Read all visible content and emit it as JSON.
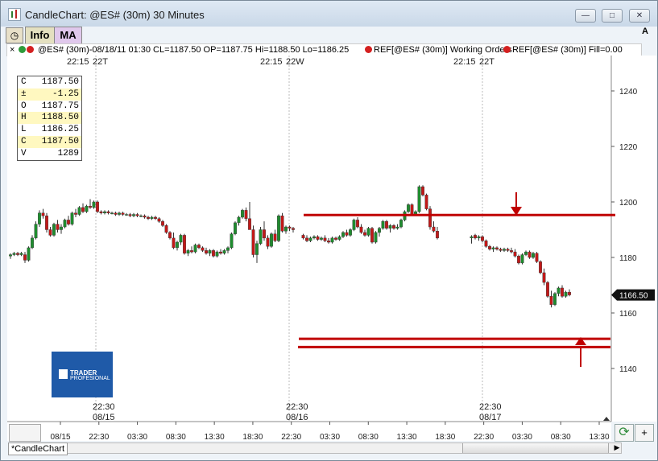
{
  "window": {
    "title": "CandleChart: @ES# (30m) 30 Minutes",
    "controls": [
      "minimize",
      "restore",
      "close"
    ]
  },
  "toolbar": {
    "clock_icon": "clock-icon",
    "info_label": "Info",
    "ma_label": "MA",
    "corner_label": "A"
  },
  "legend": {
    "close_glyph": "×",
    "series": "@ES# (30m)-08/18/11 01:30 CL=1187.50 OP=1187.75 Hi=1188.50 Lo=1186.25",
    "ref1": "REF[@ES# (30m)] Working Orders",
    "ref2": "REF[@ES# (30m)] Fill=0.00",
    "dot_colors": [
      "#2e9b3a",
      "#d42020"
    ]
  },
  "m_button": "M",
  "ohlc_box": [
    {
      "label": "C",
      "value": "1187.50",
      "highlight": false
    },
    {
      "label": "±",
      "value": "-1.25",
      "highlight": true
    },
    {
      "label": "O",
      "value": "1187.75",
      "highlight": false
    },
    {
      "label": "H",
      "value": "1188.50",
      "highlight": true
    },
    {
      "label": "L",
      "value": "1186.25",
      "highlight": false
    },
    {
      "label": "C",
      "value": "1187.50",
      "highlight": true
    },
    {
      "label": "V",
      "value": "1289",
      "highlight": false
    }
  ],
  "brand": {
    "line1": "TRADER",
    "line2": "PROFESIONAL"
  },
  "session_markers": {
    "top": [
      {
        "time": "22:15",
        "day": "22T"
      },
      {
        "time": "22:15",
        "day": "22W"
      },
      {
        "time": "22:15",
        "day": "22T"
      }
    ],
    "bottom": [
      {
        "time": "22:30",
        "date": "08/15"
      },
      {
        "time": "22:30",
        "date": "08/16"
      },
      {
        "time": "22:30",
        "date": "08/17"
      }
    ]
  },
  "current_price": "1166.50",
  "tab_label": "*CandleChart",
  "refresh_icon": "refresh-icon",
  "plus_label": "+",
  "chart_data": {
    "type": "candlestick",
    "title": "CandleChart: @ES# (30m) 30 Minutes",
    "symbol": "@ES# (30m)",
    "y_ticks": [
      1140,
      1160,
      1180,
      1200,
      1220,
      1240
    ],
    "ylim": [
      1133,
      1255
    ],
    "x_tick_labels": [
      "08/15",
      "22:30",
      "03:30",
      "08:30",
      "13:30",
      "18:30",
      "22:30",
      "03:30",
      "08:30",
      "13:30",
      "18:30",
      "22:30",
      "03:30",
      "08:30",
      "13:30"
    ],
    "last_price": 1166.5,
    "horizontal_levels": [
      {
        "value": 1195.3,
        "color": "#c00000",
        "x_range_idx": [
          121,
          248
        ],
        "marker": "down-arrow"
      },
      {
        "value": 1150.7,
        "color": "#c00000",
        "x_range_idx": [
          120,
          248
        ]
      },
      {
        "value": 1147.7,
        "color": "#c00000",
        "x_range_idx": [
          119,
          248
        ],
        "marker": "up-arrow"
      }
    ],
    "bars": [
      [
        1180.5,
        1181.5,
        1179.5,
        1181
      ],
      [
        1181,
        1182,
        1180.5,
        1181.5
      ],
      [
        1181.5,
        1182,
        1180.5,
        1181
      ],
      [
        1181,
        1182,
        1180.5,
        1181.5
      ],
      [
        1181,
        1182,
        1178,
        1179
      ],
      [
        1179,
        1184,
        1178.5,
        1183.5
      ],
      [
        1183.5,
        1188,
        1183,
        1187
      ],
      [
        1187,
        1193,
        1186.5,
        1192
      ],
      [
        1192,
        1197,
        1191,
        1196
      ],
      [
        1196,
        1197.5,
        1194,
        1195
      ],
      [
        1195,
        1196,
        1189,
        1190
      ],
      [
        1190,
        1191,
        1187.5,
        1188
      ],
      [
        1188,
        1192.5,
        1187.5,
        1192
      ],
      [
        1192,
        1193.5,
        1189,
        1190
      ],
      [
        1190,
        1192,
        1188.5,
        1191
      ],
      [
        1191,
        1194,
        1190.5,
        1193.5
      ],
      [
        1193.5,
        1195,
        1191.5,
        1192
      ],
      [
        1192,
        1196.5,
        1191.5,
        1196
      ],
      [
        1196,
        1197.5,
        1194.5,
        1195.5
      ],
      [
        1195.5,
        1198.5,
        1195,
        1198
      ],
      [
        1198,
        1199.5,
        1196,
        1196.5
      ],
      [
        1196.5,
        1199,
        1196,
        1198.5
      ],
      [
        1198.5,
        1201,
        1197.5,
        1198
      ],
      [
        1198,
        1200.5,
        1197.5,
        1200
      ],
      [
        1200,
        1200.5,
        1196,
        1196.5
      ],
      [
        1196.5,
        1197,
        1195.5,
        1196
      ],
      [
        1196,
        1197,
        1195.5,
        1196.5
      ],
      [
        1196.5,
        1197,
        1195.5,
        1196
      ],
      [
        1196,
        1196.5,
        1195.5,
        1196
      ],
      [
        1196,
        1196.5,
        1195,
        1195.5
      ],
      [
        1195.5,
        1196.5,
        1195,
        1196
      ],
      [
        1196,
        1196.5,
        1195,
        1195.5
      ],
      [
        1195.5,
        1196,
        1195,
        1195.5
      ],
      [
        1195.5,
        1196,
        1194.5,
        1195
      ],
      [
        1195,
        1196,
        1194.5,
        1195.5
      ],
      [
        1195.5,
        1196,
        1194.5,
        1195
      ],
      [
        1195,
        1195.5,
        1194.5,
        1195
      ],
      [
        1195,
        1195.5,
        1194,
        1194.5
      ],
      [
        1194.5,
        1195,
        1193.5,
        1194
      ],
      [
        1194,
        1195,
        1193.5,
        1194.5
      ],
      [
        1194.5,
        1195,
        1193.5,
        1194
      ],
      [
        1194,
        1194.5,
        1192.5,
        1193
      ],
      [
        1193,
        1193.5,
        1191,
        1191.5
      ],
      [
        1191.5,
        1192,
        1188.5,
        1189
      ],
      [
        1189,
        1189.5,
        1186.5,
        1187
      ],
      [
        1187,
        1189,
        1183,
        1183.5
      ],
      [
        1183.5,
        1186,
        1182.5,
        1185.5
      ],
      [
        1185.5,
        1188.5,
        1184.5,
        1188
      ],
      [
        1188,
        1188.5,
        1181,
        1181.5
      ],
      [
        1181.5,
        1183,
        1180.5,
        1182.5
      ],
      [
        1182.5,
        1184,
        1181.5,
        1182
      ],
      [
        1182,
        1185,
        1181.5,
        1184.5
      ],
      [
        1184.5,
        1185,
        1183,
        1183.5
      ],
      [
        1183.5,
        1184,
        1182,
        1182.5
      ],
      [
        1182.5,
        1183.5,
        1181,
        1181.5
      ],
      [
        1181.5,
        1183,
        1180.5,
        1182.5
      ],
      [
        1182.5,
        1183,
        1180,
        1180.5
      ],
      [
        1180.5,
        1182.5,
        1180,
        1182
      ],
      [
        1182,
        1183,
        1181,
        1181.5
      ],
      [
        1181.5,
        1183,
        1181,
        1182.5
      ],
      [
        1182.5,
        1184,
        1181.5,
        1183.5
      ],
      [
        1183.5,
        1189,
        1183,
        1188.5
      ],
      [
        1188.5,
        1193,
        1188,
        1192.5
      ],
      [
        1192.5,
        1195,
        1191.5,
        1194.5
      ],
      [
        1194.5,
        1197.5,
        1194,
        1197
      ],
      [
        1197,
        1198,
        1193,
        1194
      ],
      [
        1194,
        1200,
        1191,
        1190
      ],
      [
        1190,
        1191.5,
        1180,
        1181
      ],
      [
        1181,
        1186,
        1178,
        1185
      ],
      [
        1185,
        1191,
        1184.5,
        1190
      ],
      [
        1190,
        1193,
        1186,
        1187
      ],
      [
        1187,
        1188,
        1183,
        1184
      ],
      [
        1184,
        1189,
        1183.5,
        1188.5
      ],
      [
        1188.5,
        1190,
        1185.5,
        1186
      ],
      [
        1186,
        1195.5,
        1185.5,
        1195
      ],
      [
        1195,
        1196,
        1189,
        1189.5
      ],
      [
        1189.5,
        1191.5,
        1188.5,
        1191
      ],
      [
        1191,
        1191.5,
        1189.5,
        1190.5
      ],
      [
        1190.5,
        1191,
        1189,
        1190
      ],
      [
        1188,
        1188.5,
        1186.5,
        1187
      ],
      [
        1187,
        1188,
        1185.5,
        1186
      ],
      [
        1186,
        1187.5,
        1185.5,
        1187
      ],
      [
        1187,
        1188,
        1186.5,
        1187.5
      ],
      [
        1187.5,
        1188,
        1186,
        1186.5
      ],
      [
        1186.5,
        1187.5,
        1186,
        1187
      ],
      [
        1187,
        1188,
        1185.5,
        1186
      ],
      [
        1186,
        1187,
        1185,
        1185.5
      ],
      [
        1185.5,
        1187.5,
        1185,
        1187
      ],
      [
        1187,
        1187.5,
        1186,
        1186.5
      ],
      [
        1186.5,
        1188,
        1186,
        1187.5
      ],
      [
        1187.5,
        1189.5,
        1187,
        1189
      ],
      [
        1189,
        1190,
        1187.5,
        1188
      ],
      [
        1188,
        1190.5,
        1187.5,
        1190
      ],
      [
        1190,
        1194,
        1189.5,
        1193.5
      ],
      [
        1193.5,
        1194.5,
        1190.5,
        1191
      ],
      [
        1191,
        1192,
        1188.5,
        1189
      ],
      [
        1189,
        1190,
        1187.5,
        1188
      ],
      [
        1188,
        1191,
        1187.5,
        1190.5
      ],
      [
        1190.5,
        1191,
        1185,
        1185.5
      ],
      [
        1185.5,
        1189.5,
        1185,
        1189
      ],
      [
        1189,
        1191,
        1187.5,
        1190.5
      ],
      [
        1190.5,
        1193.5,
        1190,
        1193
      ],
      [
        1193,
        1193.5,
        1190,
        1190.5
      ],
      [
        1190.5,
        1192,
        1189,
        1191.5
      ],
      [
        1191.5,
        1192,
        1190,
        1190.5
      ],
      [
        1190.5,
        1192,
        1190,
        1191
      ],
      [
        1191,
        1194,
        1190.5,
        1193.5
      ],
      [
        1193.5,
        1197,
        1193,
        1196.5
      ],
      [
        1196.5,
        1199.5,
        1196,
        1199
      ],
      [
        1199,
        1199.5,
        1195,
        1195.5
      ],
      [
        1195.5,
        1197,
        1195,
        1196.5
      ],
      [
        1196.5,
        1206,
        1196,
        1205.5
      ],
      [
        1205.5,
        1206,
        1202,
        1202.5
      ],
      [
        1202.5,
        1203,
        1197,
        1197.5
      ],
      [
        1197.5,
        1198.5,
        1190,
        1191
      ],
      [
        1191,
        1193,
        1189,
        1189.5
      ],
      [
        1189.5,
        1191,
        1186.5,
        1187
      ],
      [
        1187,
        1188,
        1185,
        1187.5
      ],
      [
        1188,
        1188.5,
        1186.5,
        1187
      ],
      [
        1187,
        1188,
        1186,
        1187.5
      ],
      [
        1187.5,
        1188,
        1185.5,
        1186
      ],
      [
        1186,
        1186.5,
        1183.5,
        1184
      ],
      [
        1184,
        1184.5,
        1182.5,
        1183
      ],
      [
        1183,
        1184,
        1182,
        1183.5
      ],
      [
        1183.5,
        1184,
        1182.5,
        1183
      ],
      [
        1183,
        1183.5,
        1182,
        1182.5
      ],
      [
        1182.5,
        1183.5,
        1182,
        1183
      ],
      [
        1183,
        1183.5,
        1182,
        1182.5
      ],
      [
        1182.5,
        1183.5,
        1181.5,
        1182
      ],
      [
        1182,
        1183,
        1180,
        1180.5
      ],
      [
        1180.5,
        1181,
        1177.5,
        1178
      ],
      [
        1178,
        1181.5,
        1177.5,
        1181
      ],
      [
        1181,
        1182.5,
        1180.5,
        1182
      ],
      [
        1182,
        1182.5,
        1179.5,
        1180
      ],
      [
        1180,
        1182,
        1179.5,
        1181.5
      ],
      [
        1181.5,
        1182,
        1178,
        1178.5
      ],
      [
        1178.5,
        1179,
        1174,
        1174.5
      ],
      [
        1174.5,
        1176,
        1170,
        1171
      ],
      [
        1171,
        1171.5,
        1165.5,
        1166
      ],
      [
        1166,
        1168,
        1162,
        1163
      ],
      [
        1163,
        1167.5,
        1162.5,
        1167
      ],
      [
        1167,
        1169.5,
        1166,
        1169
      ],
      [
        1169,
        1170,
        1165.5,
        1166
      ],
      [
        1166,
        1168,
        1165.5,
        1167.5
      ],
      [
        1167.5,
        1168.5,
        1166,
        1166.5
      ]
    ]
  }
}
